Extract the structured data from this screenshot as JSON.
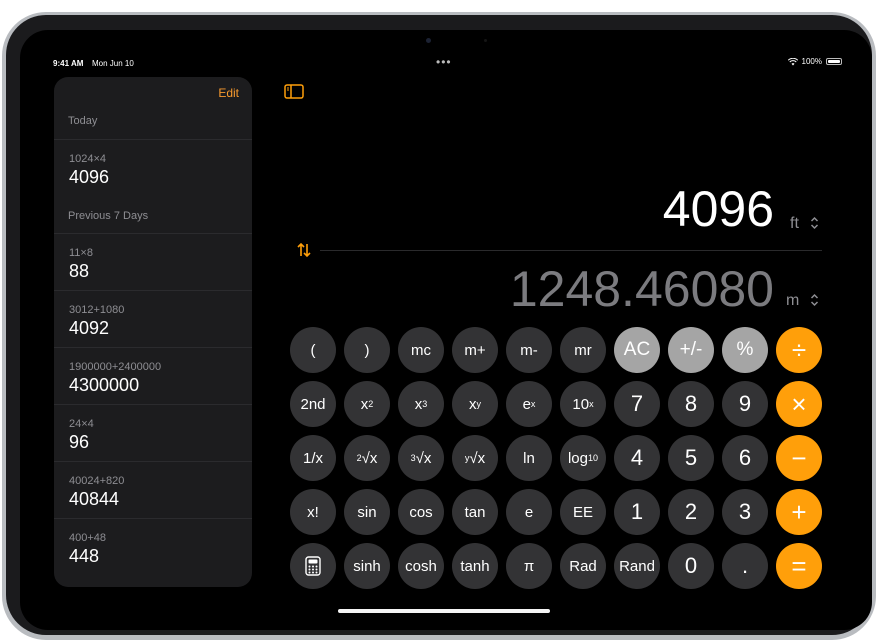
{
  "status": {
    "time": "9:41 AM",
    "date": "Mon Jun 10",
    "battery": "100%"
  },
  "sidebar": {
    "edit": "Edit",
    "sections": [
      "Today",
      "Previous 7 Days"
    ],
    "items": [
      {
        "expr": "1024×4",
        "result": "4096"
      },
      {
        "expr": "11×8",
        "result": "88"
      },
      {
        "expr": "3012+1080",
        "result": "4092"
      },
      {
        "expr": "1900000+2400000",
        "result": "4300000"
      },
      {
        "expr": "24×4",
        "result": "96"
      },
      {
        "expr": "40024+820",
        "result": "40844"
      },
      {
        "expr": "400+48",
        "result": "448"
      }
    ]
  },
  "display": {
    "top_value": "4096",
    "top_unit": "ft",
    "bottom_value": "1248.46080",
    "bottom_unit": "m"
  },
  "keys": {
    "row1": [
      "(",
      ")",
      "mc",
      "m+",
      "m-",
      "mr",
      "AC",
      "+/-",
      "%",
      "÷"
    ],
    "row2": [
      "2nd",
      "x",
      "x",
      "x",
      "e",
      "10",
      "7",
      "8",
      "9",
      "×"
    ],
    "row3": [
      "1/x",
      "√x",
      "√x",
      "√x",
      "ln",
      "log",
      "4",
      "5",
      "6",
      "−"
    ],
    "row4": [
      "x!",
      "sin",
      "cos",
      "tan",
      "e",
      "EE",
      "1",
      "2",
      "3",
      "+"
    ],
    "row5": [
      "",
      "sinh",
      "cosh",
      "tanh",
      "π",
      "Rad",
      "Rand",
      "0",
      ".",
      "="
    ],
    "sup": {
      "sq": "2",
      "cube": "3",
      "y": "y",
      "ex": "x",
      "tenx": "x",
      "root2": "2",
      "root3": "3",
      "rooty": "y",
      "log10": "10"
    }
  },
  "colors": {
    "accent": "#ff9f0a",
    "function_key": "#333335",
    "light_key": "#a5a5a5",
    "edit": "#f79a2e"
  },
  "icons": {
    "sidebar_toggle": "sidebar-toggle-icon",
    "swap": "swap-arrows-icon",
    "calculator": "calculator-icon"
  }
}
